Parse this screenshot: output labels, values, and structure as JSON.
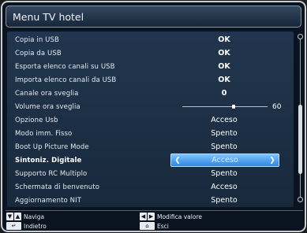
{
  "title": "Menu TV hotel",
  "rows": [
    {
      "label": "Copia in USB",
      "value": "OK"
    },
    {
      "label": "Copia da USB",
      "value": "OK"
    },
    {
      "label": "Esporta elenco canali su USB",
      "value": "OK"
    },
    {
      "label": "Importa elenco canali da USB",
      "value": "OK"
    },
    {
      "label": "Canale ora sveglia",
      "value": "0"
    },
    {
      "label": "Volume ora sveglia",
      "value": "60",
      "slider_fraction": 0.6
    },
    {
      "label": "Opzione Usb",
      "value": "Acceso"
    },
    {
      "label": "Modo imm. Fisso",
      "value": "Spento"
    },
    {
      "label": "Boot Up Picture Mode",
      "value": "Spento"
    },
    {
      "label": "Sintoniz. Digitale",
      "value": "Acceso",
      "selected": true
    },
    {
      "label": "Supporto RC Multiplo",
      "value": "Spento"
    },
    {
      "label": "Schermata di benvenuto",
      "value": "Acceso"
    },
    {
      "label": "Aggiornamento NIT",
      "value": "Spento"
    }
  ],
  "footer": {
    "navigate": "Naviga",
    "back": "Indietro",
    "modify": "Modifica valore",
    "exit": "Esci"
  },
  "icons": {
    "up_down": "up-down-arrow-keys",
    "left_right": "left-right-arrow-keys",
    "back": "back-return-key",
    "home": "home-key"
  },
  "colors": {
    "background": "#0a1420",
    "panel": "#1d3147",
    "selection": "#4aa0f0"
  }
}
